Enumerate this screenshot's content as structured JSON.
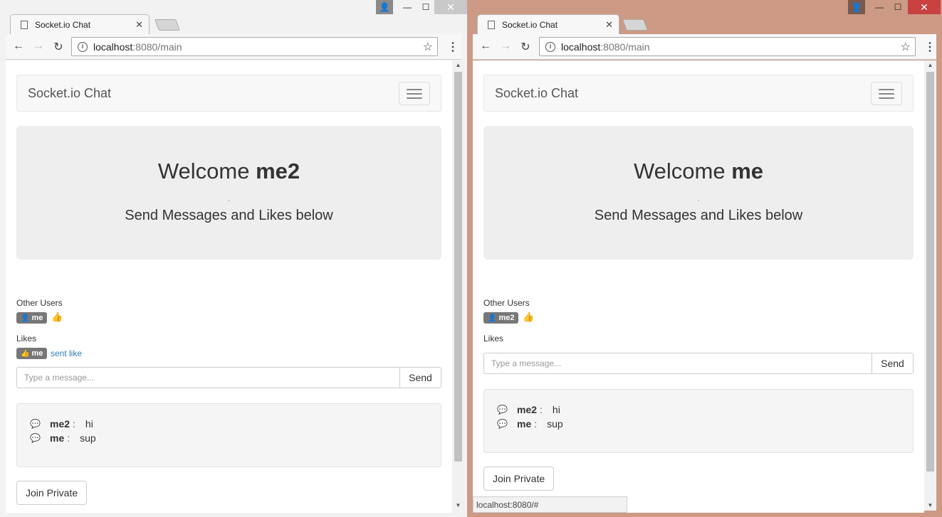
{
  "left": {
    "tab_title": "Socket.io Chat",
    "url_host": "localhost",
    "url_path": ":8080/main",
    "brand": "Socket.io Chat",
    "welcome_prefix": "Welcome ",
    "welcome_user": "me2",
    "dot": ",",
    "subtitle": "Send Messages and Likes below",
    "other_users_label": "Other Users",
    "other_user": "me",
    "likes_label": "Likes",
    "like_user": "me",
    "sent_like": "sent like",
    "message_placeholder": "Type a message...",
    "send_label": "Send",
    "messages": [
      {
        "user": "me2",
        "sep": ":",
        "text": "hi"
      },
      {
        "user": "me",
        "sep": ":",
        "text": "sup"
      }
    ],
    "join_private": "Join Private"
  },
  "right": {
    "tab_title": "Socket.io Chat",
    "url_host": "localhost",
    "url_path": ":8080/main",
    "brand": "Socket.io Chat",
    "welcome_prefix": "Welcome ",
    "welcome_user": "me",
    "dot": ",",
    "subtitle": "Send Messages and Likes below",
    "other_users_label": "Other Users",
    "other_user": "me2",
    "likes_label": "Likes",
    "message_placeholder": "Type a message...",
    "send_label": "Send",
    "messages": [
      {
        "user": "me2",
        "sep": ":",
        "text": "hi"
      },
      {
        "user": "me",
        "sep": ":",
        "text": "sup"
      }
    ],
    "join_private": "Join Private",
    "status_url": "localhost:8080/#"
  },
  "icons": {
    "tab_close": "✕",
    "back": "←",
    "forward": "→",
    "reload": "↻",
    "star": "☆",
    "menu": "⋮",
    "minimize": "—",
    "maximize": "☐",
    "close": "✕",
    "user": "👤",
    "thumbs_up": "👍",
    "bubble": "💬",
    "info": "i"
  },
  "colors": {
    "left_frame": "#f2f2f2",
    "right_frame": "#cc9a85",
    "link": "#337ab7",
    "badge": "#777777",
    "jumbotron": "#eeeeee"
  }
}
